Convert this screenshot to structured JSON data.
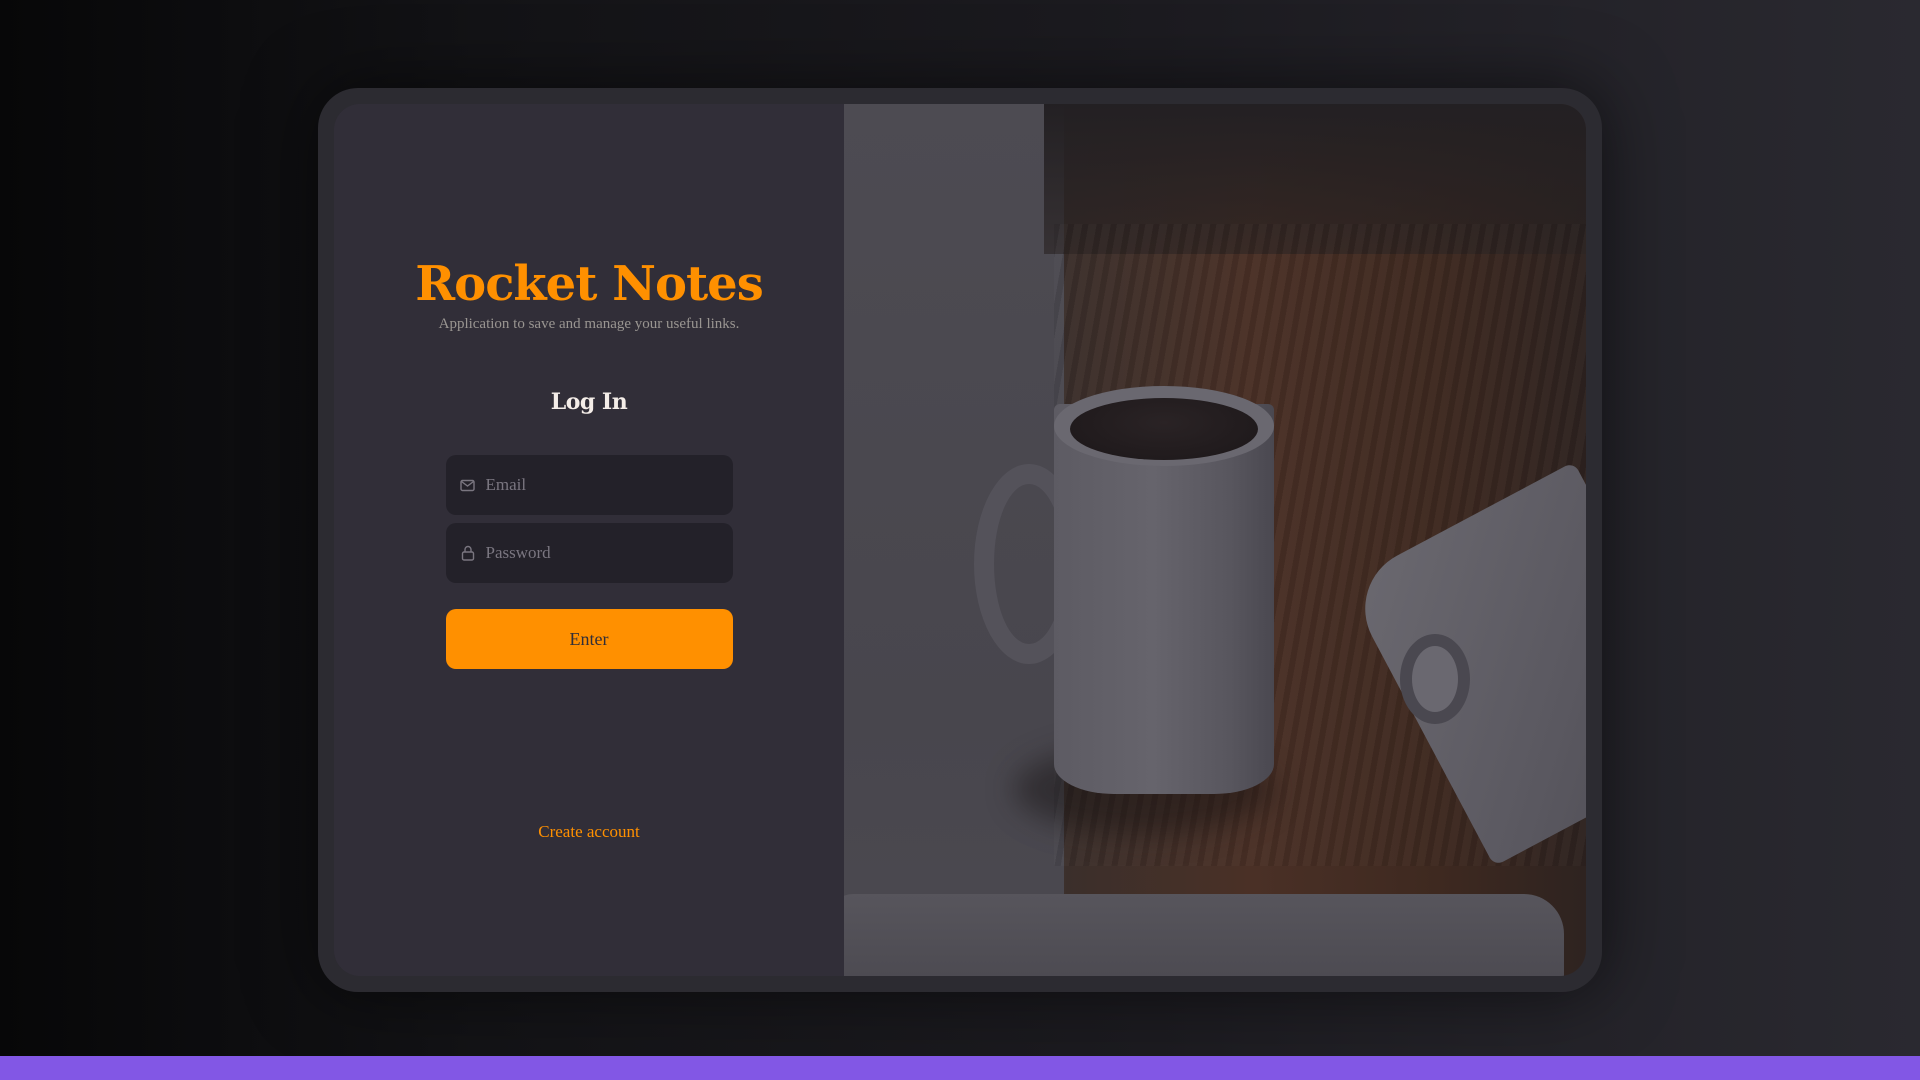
{
  "brand": {
    "title": "Rocket Notes",
    "subtitle": "Application to save and manage your useful links."
  },
  "form": {
    "heading": "Log In",
    "email_placeholder": "Email",
    "email_icon": "mail-icon",
    "password_placeholder": "Password",
    "password_icon": "lock-icon",
    "submit_label": "Enter"
  },
  "footer": {
    "create_account_label": "Create account"
  },
  "colors": {
    "accent": "#ff9000",
    "panel_background": "#312e38",
    "input_background": "#232129",
    "bottom_bar": "#8257e5"
  }
}
